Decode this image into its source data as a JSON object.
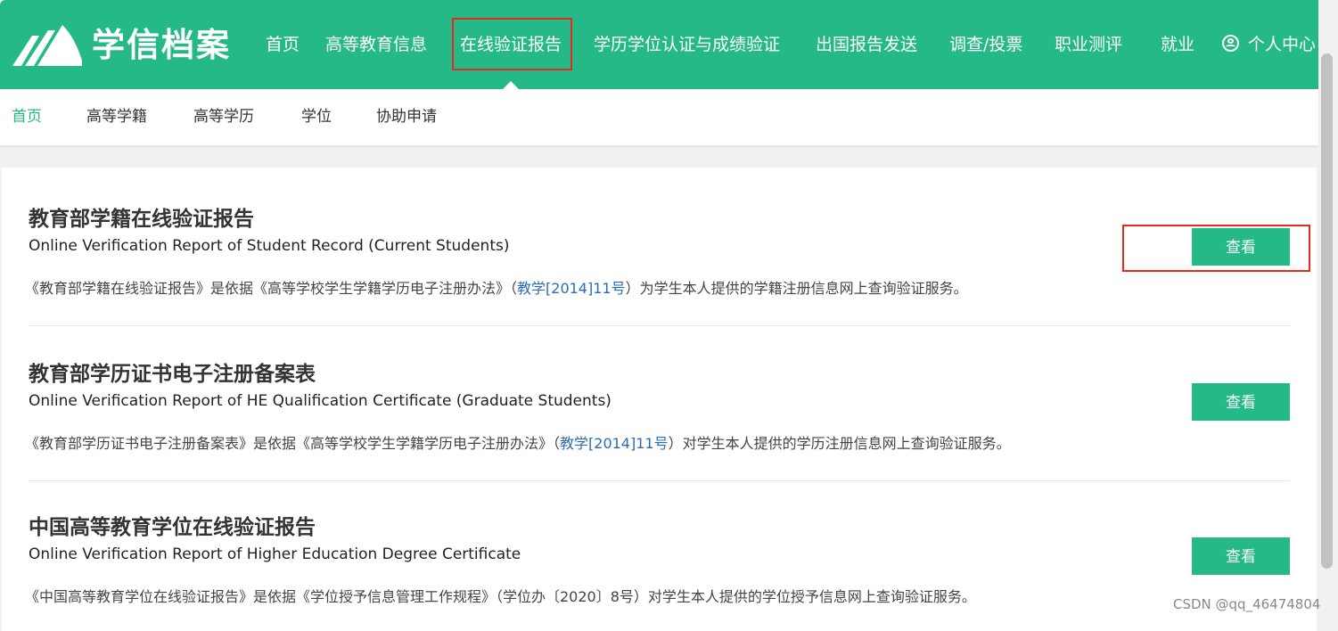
{
  "brand": {
    "name": "学信档案"
  },
  "colors": {
    "primary": "#25b987",
    "highlight": "#e8291b",
    "link": "#2a6cb8"
  },
  "nav": {
    "items": [
      {
        "label": "首页"
      },
      {
        "label": "高等教育信息"
      },
      {
        "label": "在线验证报告"
      },
      {
        "label": "学历学位认证与成绩验证"
      },
      {
        "label": "出国报告发送"
      },
      {
        "label": "调查/投票"
      },
      {
        "label": "职业测评"
      },
      {
        "label": "就业"
      }
    ],
    "active_index": 2,
    "user": {
      "label": "个人中心",
      "icon": "user-circle-icon"
    }
  },
  "subnav": {
    "items": [
      {
        "label": "首页"
      },
      {
        "label": "高等学籍"
      },
      {
        "label": "高等学历"
      },
      {
        "label": "学位"
      },
      {
        "label": "协助申请"
      }
    ],
    "active_index": 0
  },
  "reports": [
    {
      "title": "教育部学籍在线验证报告",
      "english": "Online Verification Report of Student Record (Current Students)",
      "desc_before": "《教育部学籍在线验证报告》是依据《高等学校学生学籍学历电子注册办法》（",
      "desc_link": "教学[2014]11号",
      "desc_after": "）为学生本人提供的学籍注册信息网上查询验证服务。",
      "button": "查看"
    },
    {
      "title": "教育部学历证书电子注册备案表",
      "english": "Online Verification Report of HE Qualification Certificate (Graduate Students)",
      "desc_before": "《教育部学历证书电子注册备案表》是依据《高等学校学生学籍学历电子注册办法》（",
      "desc_link": "教学[2014]11号",
      "desc_after": "）对学生本人提供的学历注册信息网上查询验证服务。",
      "button": "查看"
    },
    {
      "title": "中国高等教育学位在线验证报告",
      "english": "Online Verification Report of Higher Education Degree Certificate",
      "desc_before": "《中国高等教育学位在线验证报告》是依据《学位授予信息管理工作规程》（学位办〔2020〕8号）对学生本人提供的学位授予信息网上查询验证服务。",
      "desc_link": "",
      "desc_after": "",
      "button": "查看"
    }
  ],
  "watermark": "CSDN @qq_46474804"
}
